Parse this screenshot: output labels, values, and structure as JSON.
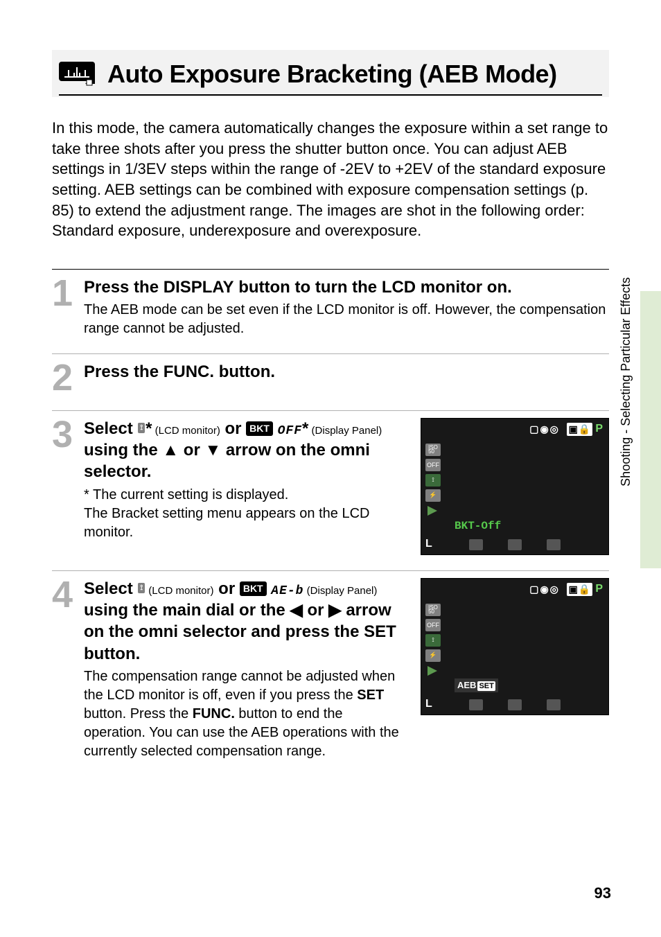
{
  "header": {
    "title": "Auto Exposure Bracketing (AEB Mode)"
  },
  "intro": "In this mode, the camera automatically changes the exposure within a set range to take three shots after you press the shutter button once. You can adjust AEB settings in 1/3EV steps within the range of -2EV to +2EV of the standard exposure setting. AEB settings can be combined with exposure compensation settings (p. 85) to extend the adjustment range. The images are shot in the following order: Standard exposure, underexposure and overexposure.",
  "steps": [
    {
      "num": "1",
      "head_pre": "Press the ",
      "head_btn": "DISPLAY",
      "head_post": " button to turn the LCD monitor on.",
      "desc": "The AEB mode can be set even if the LCD monitor is off. However, the compensation range cannot be adjusted."
    },
    {
      "num": "2",
      "head_pre": "Press the ",
      "head_btn": "FUNC.",
      "head_post": " button."
    },
    {
      "num": "3",
      "head_select": "Select ",
      "lcd_note": " (LCD monitor)",
      "bkt_label": "BKT",
      "seg_text": "OFF",
      "dp_note": " (Display Panel)",
      "using_text_a": " using the ",
      "using_text_b": " arrow on the omni selector.",
      "asterisk": "* The current setting is displayed.",
      "desc": "The Bracket setting menu appears on the LCD monitor.",
      "or": " or ",
      "or_arrow": " or ",
      "star": "*"
    },
    {
      "num": "4",
      "head_select": "Select ",
      "lcd_note": " (LCD monitor)",
      "bkt_label": "BKT",
      "seg_text": "AE-b",
      "dp_note": " (Display Panel)",
      "using_text": " using the main dial or the ",
      "using_text2": " arrow on the omni selector and press the ",
      "set_btn": "SET",
      "using_text3": " button.",
      "or": " or ",
      "or_arrow": " or ",
      "desc_a": "The compensation range cannot be adjusted when the LCD monitor is off, even if you press the ",
      "desc_set": "SET",
      "desc_b": " button. Press the ",
      "desc_func": "FUNC.",
      "desc_c": " button to end the operation. You can use the AEB operations with the currently selected compensation range."
    }
  ],
  "lcd": {
    "bkt_off": "BKT-Off",
    "aeb": "AEB",
    "set": "SET",
    "L": "L",
    "P": "P",
    "iso50": "ISO\n50",
    "off": "OFF"
  },
  "sidebar": "Shooting - Selecting Particular Effects",
  "page_num": "93"
}
